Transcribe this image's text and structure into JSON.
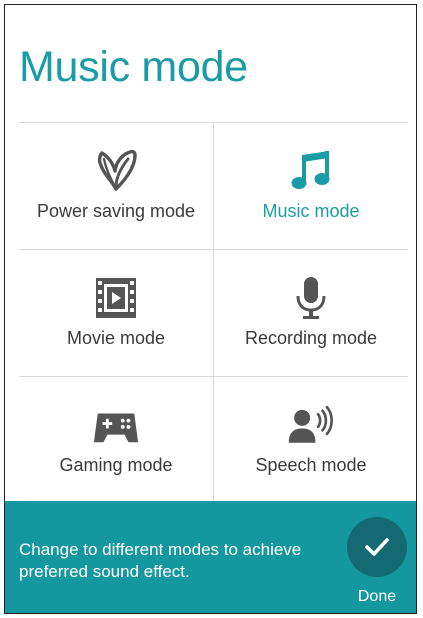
{
  "title": "Music mode",
  "modes": [
    {
      "label": "Power saving mode",
      "icon": "leaf-icon",
      "active": false
    },
    {
      "label": "Music mode",
      "icon": "music-note-icon",
      "active": true
    },
    {
      "label": "Movie mode",
      "icon": "film-icon",
      "active": false
    },
    {
      "label": "Recording mode",
      "icon": "microphone-icon",
      "active": false
    },
    {
      "label": "Gaming mode",
      "icon": "gamepad-icon",
      "active": false
    },
    {
      "label": "Speech mode",
      "icon": "speaking-person-icon",
      "active": false
    }
  ],
  "footer": {
    "hint": "Change to different modes to achieve preferred sound effect.",
    "done_label": "Done"
  },
  "colors": {
    "accent": "#1a9ca6",
    "footer_bg": "#15979f",
    "done_button": "#146a72",
    "icon": "#555555"
  }
}
